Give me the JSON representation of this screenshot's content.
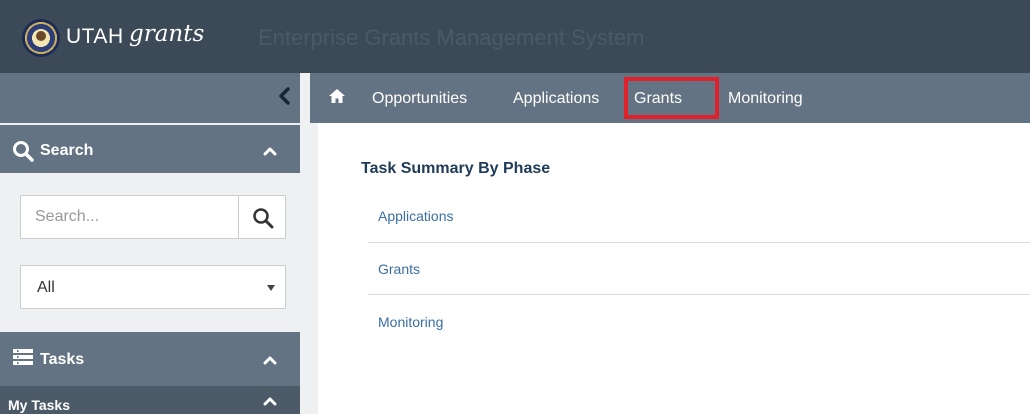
{
  "header": {
    "brand_utah": "UTAH",
    "brand_grants": "grants",
    "system_title": "Enterprise Grants Management System"
  },
  "nav": {
    "items": [
      {
        "label": "Opportunities"
      },
      {
        "label": "Applications"
      },
      {
        "label": "Grants",
        "highlighted": true
      },
      {
        "label": "Monitoring"
      }
    ],
    "highlight_color": "#e0202a"
  },
  "sidebar": {
    "search_title": "Search",
    "search_placeholder": "Search...",
    "filter_value": "All",
    "tasks_title": "Tasks",
    "my_tasks_label": "My Tasks"
  },
  "main": {
    "title": "Task Summary By Phase",
    "phases": [
      {
        "label": "Applications"
      },
      {
        "label": "Grants"
      },
      {
        "label": "Monitoring"
      }
    ]
  },
  "colors": {
    "header_bg": "#3c4a58",
    "nav_bg": "#637383",
    "link": "#3a6ea5",
    "title": "#1f3b5a"
  },
  "icons": [
    "utah-seal-logo",
    "chevron-left-icon",
    "home-icon",
    "search-icon",
    "chevron-up-icon",
    "tasks-list-icon",
    "dropdown-arrow-icon"
  ]
}
